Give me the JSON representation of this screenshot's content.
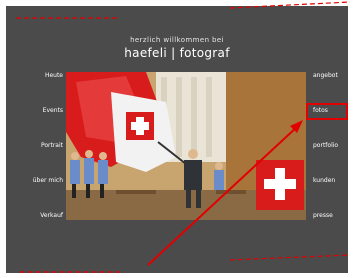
{
  "header": {
    "greeting": "herzlich willkommen bei",
    "brand": "haefeli | fotograf"
  },
  "nav_left": [
    "Heute",
    "Events",
    "Portrait",
    "über mich",
    "Verkauf"
  ],
  "nav_right": [
    "angebot",
    "fotos",
    "portfolio",
    "kunden",
    "presse"
  ],
  "active_nav": "fotos",
  "photo": {
    "description_icon": "swiss-flag-ceremony-photo"
  },
  "colors": {
    "background": "#4b4b4b",
    "accent": "#e20000",
    "text": "#ffffff"
  }
}
